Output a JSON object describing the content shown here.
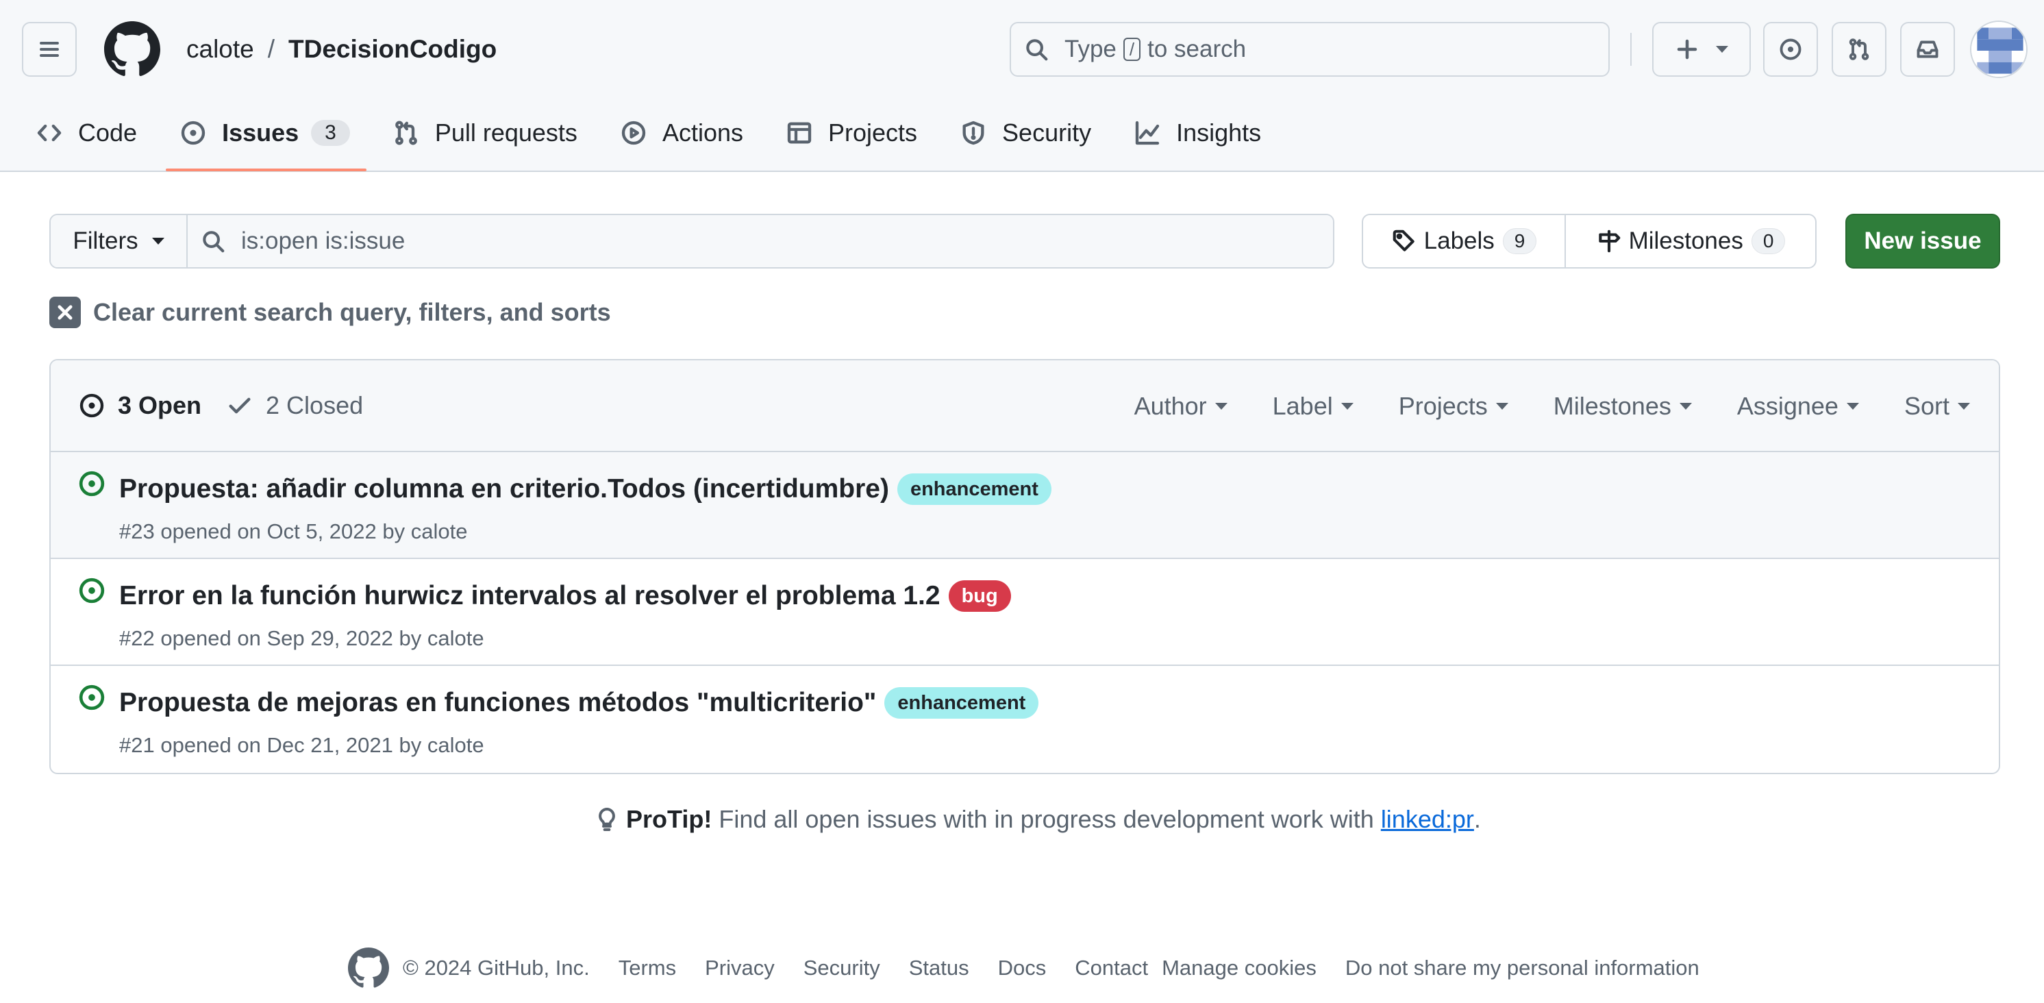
{
  "header": {
    "owner": "calote",
    "separator": "/",
    "repo": "TDecisionCodigo",
    "search": {
      "before": "Type",
      "key": "/",
      "after": "to search"
    }
  },
  "tabs": [
    {
      "label": "Code"
    },
    {
      "label": "Issues",
      "count": "3"
    },
    {
      "label": "Pull requests"
    },
    {
      "label": "Actions"
    },
    {
      "label": "Projects"
    },
    {
      "label": "Security"
    },
    {
      "label": "Insights"
    }
  ],
  "subnav": {
    "filters_label": "Filters",
    "query": "is:open is:issue",
    "labels_label": "Labels",
    "labels_count": "9",
    "milestones_label": "Milestones",
    "milestones_count": "0",
    "new_issue_label": "New issue",
    "clear_text": "Clear current search query, filters, and sorts"
  },
  "issues_header": {
    "open_label": "3 Open",
    "closed_label": "2 Closed",
    "menus": [
      "Author",
      "Label",
      "Projects",
      "Milestones",
      "Assignee",
      "Sort"
    ]
  },
  "issues": [
    {
      "title": "Propuesta: añadir columna en criterio.Todos (incertidumbre)",
      "label": "enhancement",
      "label_color": "#a2eeef",
      "label_text_color": "#1f2328",
      "meta": "#23 opened on Oct 5, 2022 by calote"
    },
    {
      "title": "Error en la función hurwicz intervalos al resolver el problema 1.2",
      "label": "bug",
      "label_color": "#d73a4a",
      "label_text_color": "#ffffff",
      "meta": "#22 opened on Sep 29, 2022 by calote"
    },
    {
      "title": "Propuesta de mejoras en funciones métodos \"multicriterio\"",
      "label": "enhancement",
      "label_color": "#a2eeef",
      "label_text_color": "#1f2328",
      "meta": "#21 opened on Dec 21, 2021 by calote"
    }
  ],
  "protip": {
    "lead": "ProTip!",
    "text": "Find all open issues with in progress development work with",
    "link": "linked:pr",
    "end": "."
  },
  "footer": {
    "copyright": "© 2024 GitHub, Inc.",
    "links": [
      "Terms",
      "Privacy",
      "Security",
      "Status",
      "Docs",
      "Contact",
      "Manage cookies",
      "Do not share my personal information"
    ]
  },
  "colors": {
    "accent_tab": "#fd8c73",
    "primary_button": "#2f7d3a",
    "open_icon": "#1a7f37",
    "link": "#0969da"
  }
}
